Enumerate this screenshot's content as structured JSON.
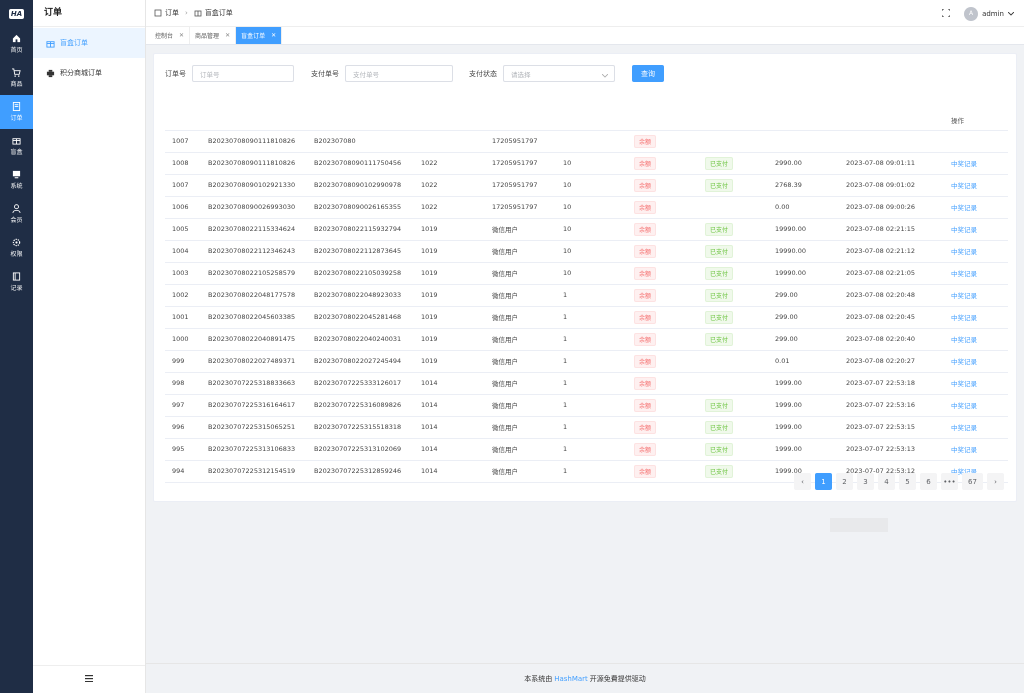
{
  "app": {
    "logo": "HA"
  },
  "rail": {
    "items": [
      {
        "label": "首页",
        "icon": "home-icon",
        "active": false
      },
      {
        "label": "商品",
        "icon": "cart-icon",
        "active": false
      },
      {
        "label": "订单",
        "icon": "order-icon",
        "active": true
      },
      {
        "label": "盲盒",
        "icon": "gift-icon",
        "active": false
      },
      {
        "label": "系统",
        "icon": "monitor-icon",
        "active": false
      },
      {
        "label": "会员",
        "icon": "user-icon",
        "active": false
      },
      {
        "label": "权限",
        "icon": "gear-icon",
        "active": false
      },
      {
        "label": "记录",
        "icon": "book-icon",
        "active": false
      }
    ]
  },
  "sidebar": {
    "title": "订单",
    "items": [
      {
        "label": "盲盒订单",
        "icon": "gift-icon",
        "active": true
      },
      {
        "label": "积分商城订单",
        "icon": "printer-icon",
        "active": false
      }
    ]
  },
  "header": {
    "breadcrumb": [
      {
        "label": "订单",
        "icon": "order-icon"
      },
      {
        "label": "盲盒订单",
        "icon": "gift-icon"
      }
    ],
    "user": "admin",
    "avatar_text": "A"
  },
  "tabs": [
    {
      "label": "控制台",
      "active": false
    },
    {
      "label": "商品管理",
      "active": false
    },
    {
      "label": "盲盒订单",
      "active": true
    }
  ],
  "filters": {
    "order_no_label": "订单号",
    "order_no_placeholder": "订单号",
    "pay_no_label": "支付单号",
    "pay_no_placeholder": "支付单号",
    "pay_status_label": "支付状态",
    "pay_status_placeholder": "请选择",
    "search_button": "查询"
  },
  "table": {
    "action_header": "操作",
    "rows": [
      {
        "id": "1007",
        "order_no": "B20230708090111810826",
        "pay_no": "B202307080",
        "uid": "",
        "phone": "17205951797",
        "qty": "",
        "status": "余额",
        "paid": "",
        "amount": "",
        "time": "",
        "action": ""
      },
      {
        "id": "1008",
        "order_no": "B20230708090111810826",
        "pay_no": "B20230708090111750456",
        "uid": "1022",
        "phone": "17205951797",
        "qty": "10",
        "status": "余额",
        "paid": "已支付",
        "amount": "2990.00",
        "time": "2023-07-08 09:01:11",
        "action": "中奖记录"
      },
      {
        "id": "1007",
        "order_no": "B20230708090102921330",
        "pay_no": "B20230708090102990978",
        "uid": "1022",
        "phone": "17205951797",
        "qty": "10",
        "status": "余额",
        "paid": "已支付",
        "amount": "2768.39",
        "time": "2023-07-08 09:01:02",
        "action": "中奖记录"
      },
      {
        "id": "1006",
        "order_no": "B20230708090026993030",
        "pay_no": "B20230708090026165355",
        "uid": "1022",
        "phone": "17205951797",
        "qty": "10",
        "status": "余额",
        "paid": "",
        "amount": "0.00",
        "time": "2023-07-08 09:00:26",
        "action": "中奖记录"
      },
      {
        "id": "1005",
        "order_no": "B20230708022115334624",
        "pay_no": "B20230708022115932794",
        "uid": "1019",
        "phone": "微信用户",
        "qty": "10",
        "status": "余额",
        "paid": "已支付",
        "amount": "19990.00",
        "time": "2023-07-08 02:21:15",
        "action": "中奖记录"
      },
      {
        "id": "1004",
        "order_no": "B20230708022112346243",
        "pay_no": "B20230708022112873645",
        "uid": "1019",
        "phone": "微信用户",
        "qty": "10",
        "status": "余额",
        "paid": "已支付",
        "amount": "19990.00",
        "time": "2023-07-08 02:21:12",
        "action": "中奖记录"
      },
      {
        "id": "1003",
        "order_no": "B20230708022105258579",
        "pay_no": "B20230708022105039258",
        "uid": "1019",
        "phone": "微信用户",
        "qty": "10",
        "status": "余额",
        "paid": "已支付",
        "amount": "19990.00",
        "time": "2023-07-08 02:21:05",
        "action": "中奖记录"
      },
      {
        "id": "1002",
        "order_no": "B20230708022048177578",
        "pay_no": "B20230708022048923033",
        "uid": "1019",
        "phone": "微信用户",
        "qty": "1",
        "status": "余额",
        "paid": "已支付",
        "amount": "299.00",
        "time": "2023-07-08 02:20:48",
        "action": "中奖记录"
      },
      {
        "id": "1001",
        "order_no": "B20230708022045603385",
        "pay_no": "B20230708022045281468",
        "uid": "1019",
        "phone": "微信用户",
        "qty": "1",
        "status": "余额",
        "paid": "已支付",
        "amount": "299.00",
        "time": "2023-07-08 02:20:45",
        "action": "中奖记录"
      },
      {
        "id": "1000",
        "order_no": "B20230708022040891475",
        "pay_no": "B20230708022040240031",
        "uid": "1019",
        "phone": "微信用户",
        "qty": "1",
        "status": "余额",
        "paid": "已支付",
        "amount": "299.00",
        "time": "2023-07-08 02:20:40",
        "action": "中奖记录"
      },
      {
        "id": "999",
        "order_no": "B20230708022027489371",
        "pay_no": "B20230708022027245494",
        "uid": "1019",
        "phone": "微信用户",
        "qty": "1",
        "status": "余额",
        "paid": "",
        "amount": "0.01",
        "time": "2023-07-08 02:20:27",
        "action": "中奖记录"
      },
      {
        "id": "998",
        "order_no": "B20230707225318833663",
        "pay_no": "B20230707225333126017",
        "uid": "1014",
        "phone": "微信用户",
        "qty": "1",
        "status": "余额",
        "paid": "",
        "amount": "1999.00",
        "time": "2023-07-07 22:53:18",
        "action": "中奖记录"
      },
      {
        "id": "997",
        "order_no": "B20230707225316164617",
        "pay_no": "B20230707225316089826",
        "uid": "1014",
        "phone": "微信用户",
        "qty": "1",
        "status": "余额",
        "paid": "已支付",
        "amount": "1999.00",
        "time": "2023-07-07 22:53:16",
        "action": "中奖记录"
      },
      {
        "id": "996",
        "order_no": "B20230707225315065251",
        "pay_no": "B20230707225315518318",
        "uid": "1014",
        "phone": "微信用户",
        "qty": "1",
        "status": "余额",
        "paid": "已支付",
        "amount": "1999.00",
        "time": "2023-07-07 22:53:15",
        "action": "中奖记录"
      },
      {
        "id": "995",
        "order_no": "B20230707225313106833",
        "pay_no": "B20230707225313102069",
        "uid": "1014",
        "phone": "微信用户",
        "qty": "1",
        "status": "余额",
        "paid": "已支付",
        "amount": "1999.00",
        "time": "2023-07-07 22:53:13",
        "action": "中奖记录"
      },
      {
        "id": "994",
        "order_no": "B20230707225312154519",
        "pay_no": "B20230707225312859246",
        "uid": "1014",
        "phone": "微信用户",
        "qty": "1",
        "status": "余额",
        "paid": "已支付",
        "amount": "1999.00",
        "time": "2023-07-07 22:53:12",
        "action": "中奖记录"
      }
    ]
  },
  "pagination": {
    "pages": [
      "1",
      "2",
      "3",
      "4",
      "5",
      "6"
    ],
    "ellipsis": "•••",
    "last": "67",
    "current": "1",
    "prev": "‹",
    "next": "›"
  },
  "footer": {
    "prefix": "本系统由",
    "brand": "HashMart",
    "suffix": "开源免費提供驱动"
  },
  "colors": {
    "primary": "#409eff",
    "rail_bg": "#1f2d45",
    "danger": "#f56c6c",
    "success": "#67c23a"
  }
}
